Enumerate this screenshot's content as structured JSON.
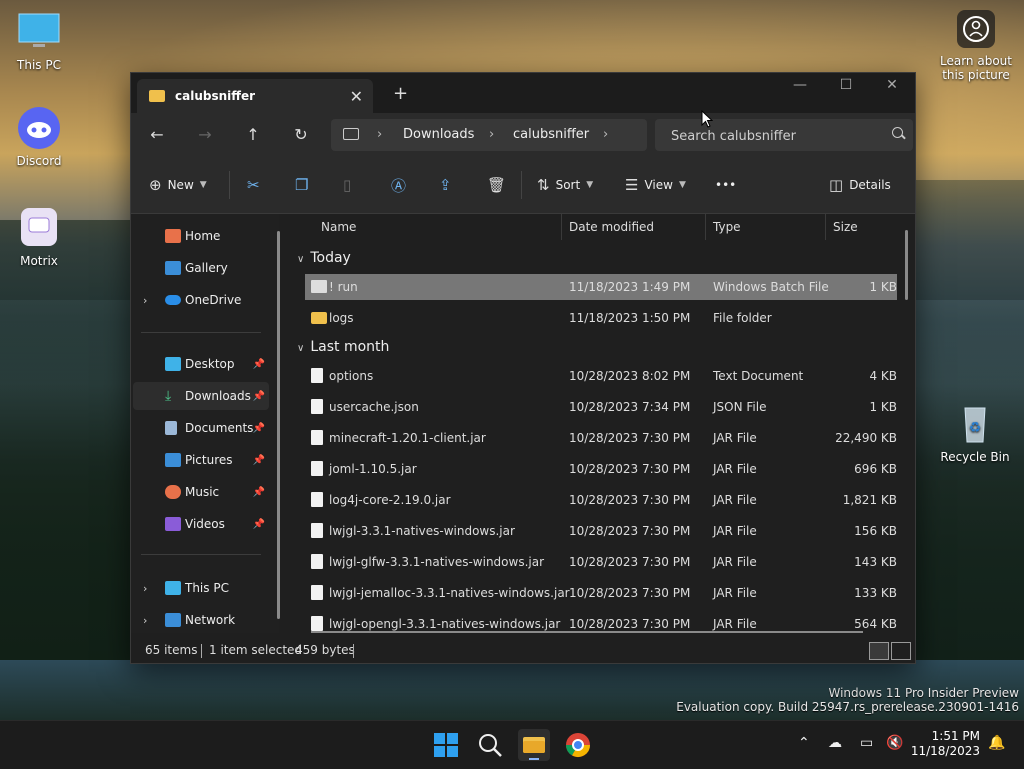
{
  "desktop": {
    "icons": [
      {
        "label": "This PC"
      },
      {
        "label": "Discord"
      },
      {
        "label": "Motrix"
      },
      {
        "label": "Recycle Bin"
      }
    ],
    "learn_label": "Learn about this picture",
    "watermark_line1": "Windows 11 Pro Insider Preview",
    "watermark_line2": "Evaluation copy. Build 25947.rs_prerelease.230901-1416"
  },
  "window": {
    "tab_title": "calubsniffer",
    "new_tab": "+",
    "controls": {
      "minimize": "—",
      "maximize": "☐",
      "close": "✕"
    }
  },
  "address": {
    "crumbs": [
      "Downloads",
      "calubsniffer"
    ],
    "search_placeholder": "Search calubsniffer"
  },
  "toolbar": {
    "new_label": "New",
    "sort_label": "Sort",
    "view_label": "View",
    "more_label": "•••",
    "details_label": "Details"
  },
  "sidebar": {
    "items": [
      {
        "label": "Home"
      },
      {
        "label": "Gallery"
      },
      {
        "label": "OneDrive"
      },
      {
        "label": "Desktop"
      },
      {
        "label": "Downloads"
      },
      {
        "label": "Documents"
      },
      {
        "label": "Pictures"
      },
      {
        "label": "Music"
      },
      {
        "label": "Videos"
      },
      {
        "label": "This PC"
      },
      {
        "label": "Network"
      }
    ]
  },
  "columns": {
    "name": "Name",
    "date": "Date modified",
    "type": "Type",
    "size": "Size"
  },
  "groups": {
    "today": "Today",
    "last_month": "Last month"
  },
  "files": {
    "today": [
      {
        "name": "! run",
        "date": "11/18/2023 1:49 PM",
        "type": "Windows Batch File",
        "size": "1 KB"
      },
      {
        "name": "logs",
        "date": "11/18/2023 1:50 PM",
        "type": "File folder",
        "size": ""
      }
    ],
    "last_month": [
      {
        "name": "options",
        "date": "10/28/2023 8:02 PM",
        "type": "Text Document",
        "size": "4 KB"
      },
      {
        "name": "usercache.json",
        "date": "10/28/2023 7:34 PM",
        "type": "JSON File",
        "size": "1 KB"
      },
      {
        "name": "minecraft-1.20.1-client.jar",
        "date": "10/28/2023 7:30 PM",
        "type": "JAR File",
        "size": "22,490 KB"
      },
      {
        "name": "joml-1.10.5.jar",
        "date": "10/28/2023 7:30 PM",
        "type": "JAR File",
        "size": "696 KB"
      },
      {
        "name": "log4j-core-2.19.0.jar",
        "date": "10/28/2023 7:30 PM",
        "type": "JAR File",
        "size": "1,821 KB"
      },
      {
        "name": "lwjgl-3.3.1-natives-windows.jar",
        "date": "10/28/2023 7:30 PM",
        "type": "JAR File",
        "size": "156 KB"
      },
      {
        "name": "lwjgl-glfw-3.3.1-natives-windows.jar",
        "date": "10/28/2023 7:30 PM",
        "type": "JAR File",
        "size": "143 KB"
      },
      {
        "name": "lwjgl-jemalloc-3.3.1-natives-windows.jar",
        "date": "10/28/2023 7:30 PM",
        "type": "JAR File",
        "size": "133 KB"
      },
      {
        "name": "lwjgl-opengl-3.3.1-natives-windows.jar",
        "date": "10/28/2023 7:30 PM",
        "type": "JAR File",
        "size": "564 KB"
      }
    ]
  },
  "status": {
    "count": "65 items",
    "selected": "1 item selected",
    "bytes": "459 bytes"
  },
  "taskbar": {
    "time": "1:51 PM",
    "date": "11/18/2023"
  }
}
